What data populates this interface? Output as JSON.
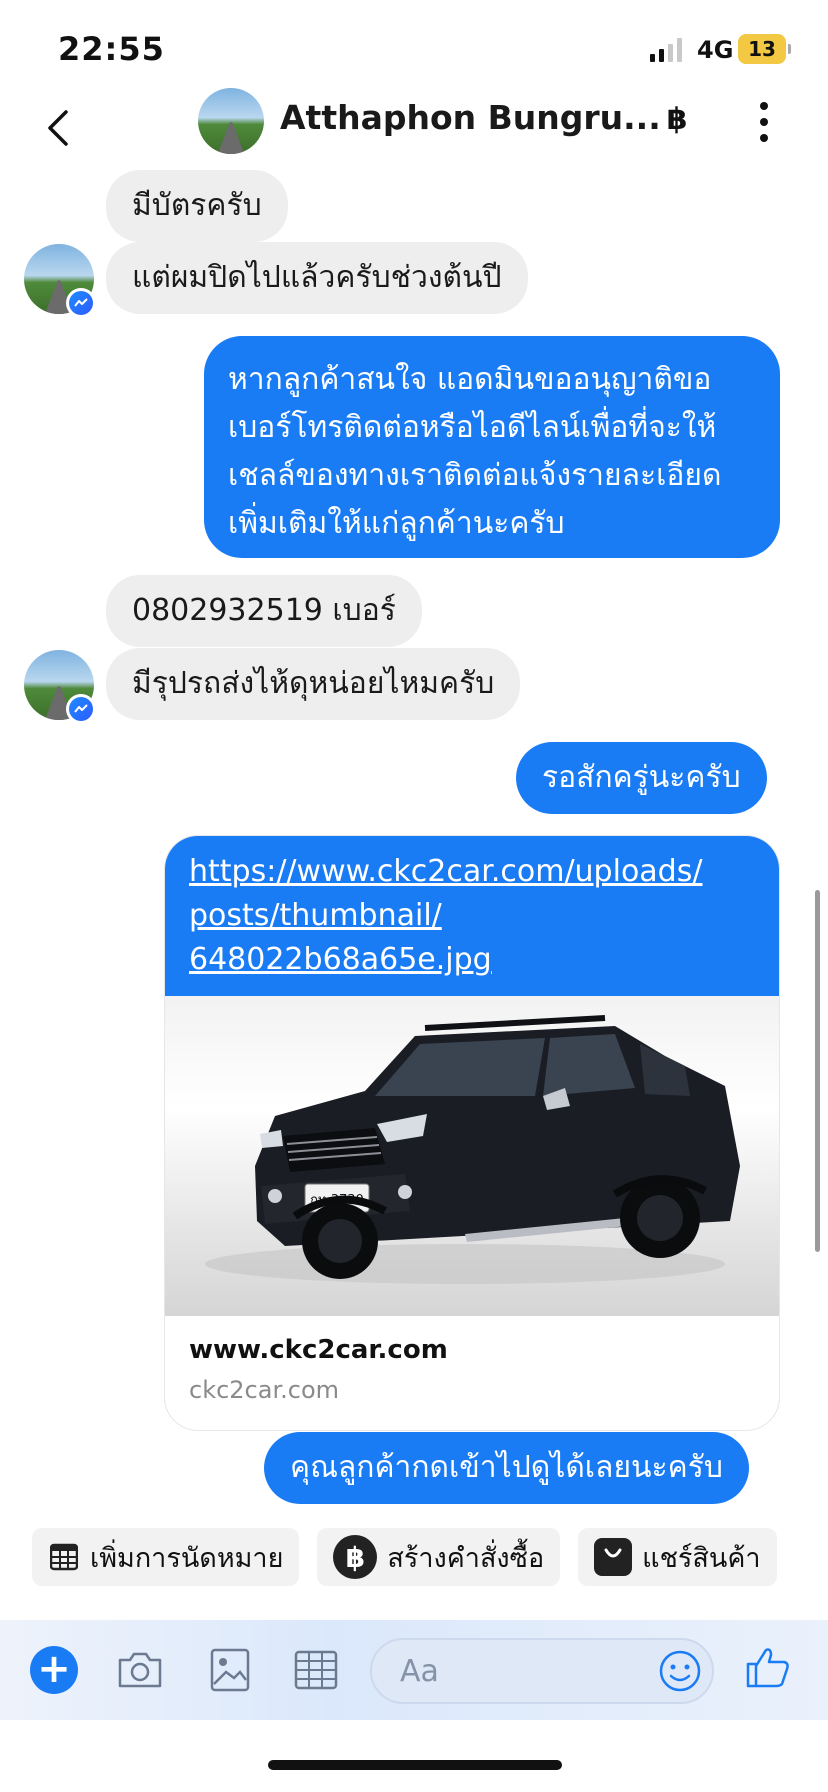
{
  "status_bar": {
    "time": "22:55",
    "network": "4G",
    "battery": "13"
  },
  "header": {
    "contact_name": "Atthaphon Bungru...",
    "currency_icon": "baht-icon"
  },
  "messages": {
    "m1": "มีบัตรครับ",
    "m2": "แต่ผมปิดไปแล้วครับช่วงต้นปี",
    "m3_lines": [
      "หากลูกค้าสนใจ แอดมินขออนุญาติขอ",
      "เบอร์โทรติดต่อหรือไอดีไลน์เพื่อที่จะให้",
      "เชลล์ของทางเราติดต่อแจ้งรายละเอียด",
      "เพิ่มเติมให้แก่ลูกค้านะครับ"
    ],
    "m4": "0802932519 เบอร์",
    "m5": "มีรุปรถส่งไห้ดุหน่อยไหมครับ",
    "m6": "รอสักครู่นะครับ",
    "link_lines": [
      "https://www.ckc2car.com/uploads/",
      "posts/thumbnail/",
      "648022b68a65e.jpg"
    ],
    "link_title": "www.ckc2car.com",
    "link_domain": "ckc2car.com",
    "plate": "กท 3730",
    "m7": "คุณลูกค้ากดเข้าไปดูได้เลยนะครับ"
  },
  "quick_actions": [
    {
      "label": "เพิ่มการนัดหมาย",
      "icon": "calendar-grid-icon"
    },
    {
      "label": "สร้างคำสั่งซื้อ",
      "icon": "baht-circle-icon"
    },
    {
      "label": "แชร์สินค้า",
      "icon": "shopping-bag-icon"
    }
  ],
  "composer": {
    "placeholder": "Aa"
  },
  "colors": {
    "accent": "#1a7cf5",
    "incoming_bubble": "#eeeeee"
  }
}
